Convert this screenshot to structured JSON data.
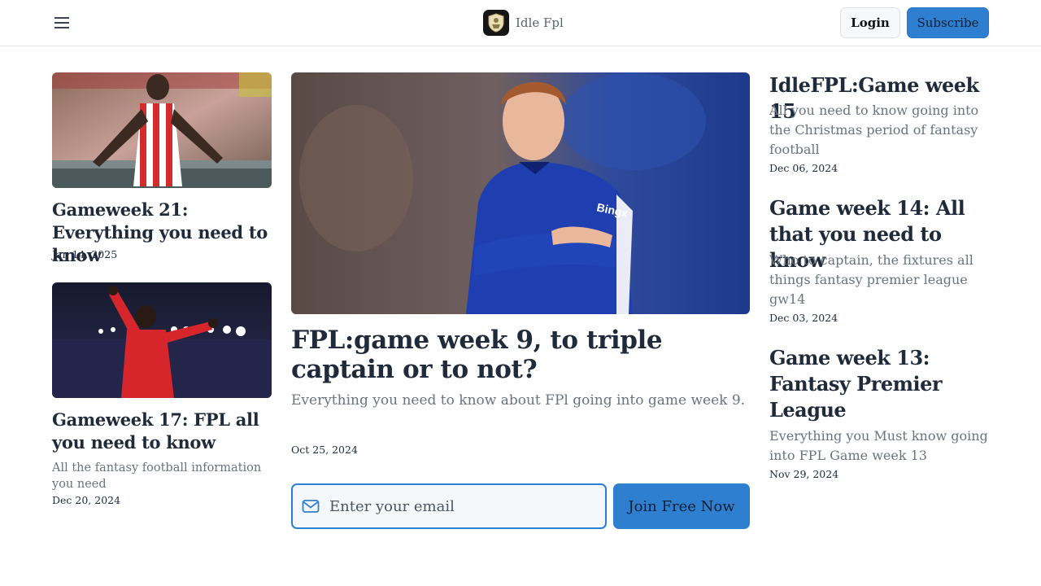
{
  "header": {
    "brand_name": "Idle Fpl",
    "login_label": "Login",
    "subscribe_label": "Subscribe",
    "icons": [
      "menu-icon",
      "brand-logo-icon"
    ]
  },
  "left_articles": [
    {
      "title": "Gameweek 21: Everything you need to know",
      "date": "Jan 14, 2025",
      "image": "player in red and white striped kit celebrating"
    },
    {
      "title": "Gameweek 17: FPL all you need to know",
      "description": "All the fantasy football information you need",
      "date": "Dec 20, 2024",
      "image": "player in red kit celebrating under stadium lights"
    }
  ],
  "featured": {
    "title": "FPL:game week 9, to triple captain or to not?",
    "description": "Everything you need to know about FPl going into game week 9.",
    "date": "Oct 25, 2024",
    "image": "player in blue kit with arms crossed"
  },
  "signup": {
    "email_placeholder": "Enter your email",
    "join_label": "Join Free Now",
    "icon": "mail-icon"
  },
  "right_articles": [
    {
      "title": "IdleFPL:Game week 15",
      "description": "All you need to know going into the Christmas period of fantasy football",
      "date": "Dec 06, 2024"
    },
    {
      "title": "Game week 14: All that you need to know",
      "description": "Who to captain, the fixtures all things fantasy premier league gw14",
      "date": "Dec 03, 2024"
    },
    {
      "title": "Game week 13: Fantasy Premier League",
      "description": "Everything you Must know going into FPL Game week 13",
      "date": "Nov 29, 2024"
    }
  ]
}
